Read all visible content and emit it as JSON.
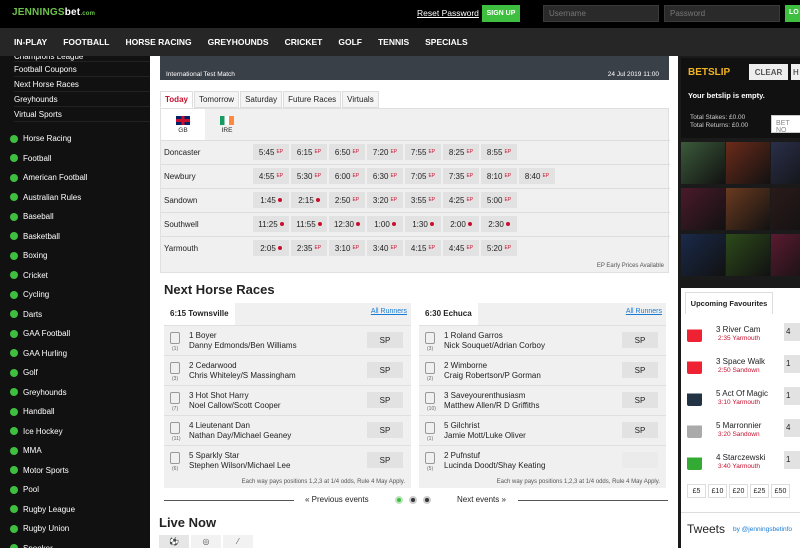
{
  "header": {
    "brand": "JENNINGS",
    "brand_suffix": "bet",
    "brand_tld": ".com",
    "reset": "Reset Password",
    "signup": "SIGN UP",
    "username_ph": "Username",
    "password_ph": "Password",
    "login": "LO"
  },
  "nav": [
    "IN-PLAY",
    "FOOTBALL",
    "HORSE RACING",
    "GREYHOUNDS",
    "CRICKET",
    "GOLF",
    "TENNIS",
    "SPECIALS"
  ],
  "sidebar": {
    "sub": [
      "Champions League",
      "Football Coupons",
      "Next Horse Races",
      "Greyhounds",
      "Virtual Sports"
    ],
    "sports": [
      "Horse Racing",
      "Football",
      "American Football",
      "Australian Rules",
      "Baseball",
      "Basketball",
      "Boxing",
      "Cricket",
      "Cycling",
      "Darts",
      "GAA Football",
      "GAA Hurling",
      "Golf",
      "Greyhounds",
      "Handball",
      "Ice Hockey",
      "MMA",
      "Motor Sports",
      "Pool",
      "Rugby League",
      "Rugby Union",
      "Snooker"
    ]
  },
  "hero": {
    "title": "International Test Match",
    "date": "24 Jul 2019 11:00"
  },
  "day_tabs": [
    "Today",
    "Tomorrow",
    "Saturday",
    "Future Races",
    "Virtuals"
  ],
  "flags": [
    "GB",
    "IRE"
  ],
  "meetings": [
    {
      "name": "Doncaster",
      "times": [
        {
          "t": "5:45",
          "m": "EP"
        },
        {
          "t": "6:15",
          "m": "EP"
        },
        {
          "t": "6:50",
          "m": "EP"
        },
        {
          "t": "7:20",
          "m": "EP"
        },
        {
          "t": "7:55",
          "m": "EP"
        },
        {
          "t": "8:25",
          "m": "EP"
        },
        {
          "t": "8:55",
          "m": "EP"
        }
      ]
    },
    {
      "name": "Newbury",
      "times": [
        {
          "t": "4:55",
          "m": "EP"
        },
        {
          "t": "5:30",
          "m": "EP"
        },
        {
          "t": "6:00",
          "m": "EP"
        },
        {
          "t": "6:30",
          "m": "EP"
        },
        {
          "t": "7:05",
          "m": "EP"
        },
        {
          "t": "7:35",
          "m": "EP"
        },
        {
          "t": "8:10",
          "m": "EP"
        },
        {
          "t": "8:40",
          "m": "EP"
        }
      ]
    },
    {
      "name": "Sandown",
      "times": [
        {
          "t": "1:45",
          "m": "dot"
        },
        {
          "t": "2:15",
          "m": "dot"
        },
        {
          "t": "2:50",
          "m": "EP"
        },
        {
          "t": "3:20",
          "m": "EP"
        },
        {
          "t": "3:55",
          "m": "EP"
        },
        {
          "t": "4:25",
          "m": "EP"
        },
        {
          "t": "5:00",
          "m": "EP"
        }
      ]
    },
    {
      "name": "Southwell",
      "times": [
        {
          "t": "11:25",
          "m": "dot"
        },
        {
          "t": "11:55",
          "m": "dot"
        },
        {
          "t": "12:30",
          "m": "dot"
        },
        {
          "t": "1:00",
          "m": "dot"
        },
        {
          "t": "1:30",
          "m": "dot"
        },
        {
          "t": "2:00",
          "m": "dot"
        },
        {
          "t": "2:30",
          "m": "dot"
        }
      ]
    },
    {
      "name": "Yarmouth",
      "times": [
        {
          "t": "2:05",
          "m": "dot"
        },
        {
          "t": "2:35",
          "m": "EP"
        },
        {
          "t": "3:10",
          "m": "EP"
        },
        {
          "t": "3:40",
          "m": "EP"
        },
        {
          "t": "4:15",
          "m": "EP"
        },
        {
          "t": "4:45",
          "m": "EP"
        },
        {
          "t": "5:20",
          "m": "EP"
        }
      ]
    }
  ],
  "ep_note": "EP Early Prices Available",
  "next_title": "Next Horse Races",
  "all_runners": "All Runners",
  "races": [
    {
      "title": "6:15 Townsville",
      "runners": [
        {
          "n": "(1)",
          "name": "1 Boyer",
          "jockey": "Danny Edmonds/Ben Williams",
          "price": "SP"
        },
        {
          "n": "(3)",
          "name": "2 Cedarwood",
          "jockey": "Chris Whiteley/S Massingham",
          "price": "SP"
        },
        {
          "n": "(7)",
          "name": "3 Hot Shot Harry",
          "jockey": "Noel Callow/Scott Cooper",
          "price": "SP"
        },
        {
          "n": "(11)",
          "name": "4 Lieutenant Dan",
          "jockey": "Nathan Day/Michael Geaney",
          "price": "SP"
        },
        {
          "n": "(6)",
          "name": "5 Sparkly Star",
          "jockey": "Stephen Wilson/Michael Lee",
          "price": "SP"
        }
      ]
    },
    {
      "title": "6:30 Echuca",
      "runners": [
        {
          "n": "(3)",
          "name": "1 Roland Garros",
          "jockey": "Nick Souquet/Adrian Corboy",
          "price": "SP"
        },
        {
          "n": "(2)",
          "name": "2 Wimborne",
          "jockey": "Craig Robertson/P Gorman",
          "price": "SP"
        },
        {
          "n": "(10)",
          "name": "3 Saveyourenthusiasm",
          "jockey": "Matthew Allen/R D Griffiths",
          "price": "SP"
        },
        {
          "n": "(1)",
          "name": "5 Gilchrist",
          "jockey": "Jamie Mott/Luke Oliver",
          "price": "SP"
        },
        {
          "n": "(5)",
          "name": "2 Pufnstuf",
          "jockey": "Lucinda Doodt/Shay Keating",
          "price": ""
        }
      ]
    }
  ],
  "each_way": "Each way pays positions 1,2,3 at 1/4 odds, Rule 4 May Apply.",
  "prev": "« Previous events",
  "next": "Next events »",
  "live_title": "Live Now",
  "betslip": {
    "title": "BETSLIP",
    "clear": "CLEAR",
    "h": "H",
    "empty": "Your betslip is empty.",
    "stakes": "Total Stakes: £0.00",
    "returns": "Total Returns: £0.00",
    "betnow": "BET NO"
  },
  "upcoming": {
    "tab": "Upcoming Favourites",
    "items": [
      {
        "name": "3 River Cam",
        "time": "2:35 Yarmouth",
        "odds": "4"
      },
      {
        "name": "3 Space Walk",
        "time": "2:50 Sandown",
        "odds": "1"
      },
      {
        "name": "5 Act Of Magic",
        "time": "3:10 Yarmouth",
        "odds": "1"
      },
      {
        "name": "5 Marronnier",
        "time": "3:20 Sandown",
        "odds": "4"
      },
      {
        "name": "4 Starczewski",
        "time": "3:40 Yarmouth",
        "odds": "1"
      }
    ],
    "stakes": [
      "£5",
      "£10",
      "£20",
      "£25",
      "£50"
    ]
  },
  "tweets": {
    "title": "Tweets",
    "by": "by @jenningsbetinfo"
  }
}
